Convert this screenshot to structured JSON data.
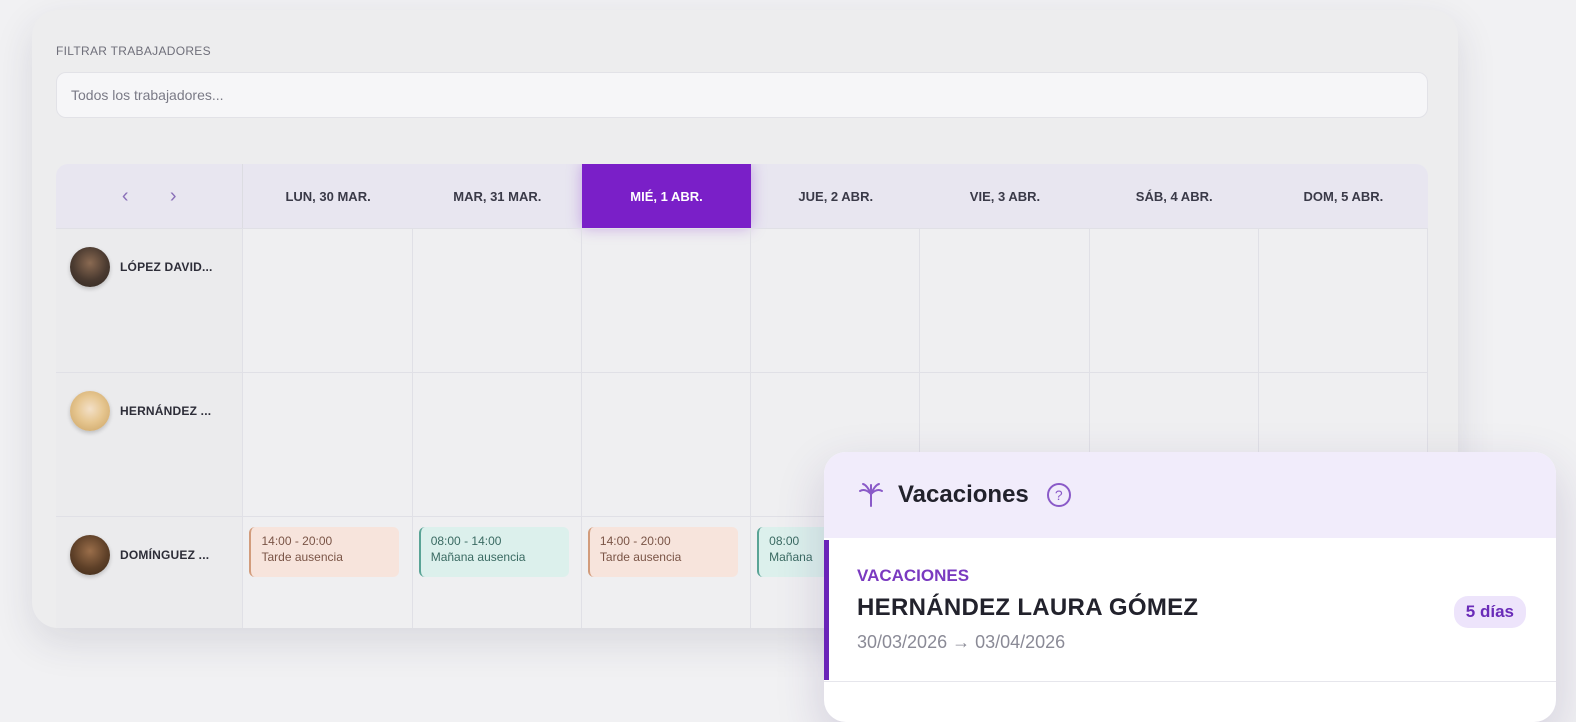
{
  "filter": {
    "label": "FILTRAR TRABAJADORES",
    "placeholder": "Todos los trabajadores..."
  },
  "calendar": {
    "nav": {
      "prev_icon": "chevron-left-icon",
      "next_icon": "chevron-right-icon"
    },
    "days": [
      {
        "label": "LUN, 30 MAR.",
        "today": false
      },
      {
        "label": "MAR, 31 MAR.",
        "today": false
      },
      {
        "label": "MIÉ, 1 ABR.",
        "today": true
      },
      {
        "label": "JUE, 2 ABR.",
        "today": false
      },
      {
        "label": "VIE, 3 ABR.",
        "today": false
      },
      {
        "label": "SÁB, 4 ABR.",
        "today": false
      },
      {
        "label": "DOM, 5 ABR.",
        "today": false
      }
    ],
    "employees": [
      {
        "name": "LÓPEZ DAVID..."
      },
      {
        "name": "HERNÁNDEZ ..."
      },
      {
        "name": "DOMÍNGUEZ ..."
      }
    ],
    "shifts": [
      {
        "time": "14:00 - 20:00",
        "label": "Tarde ausencia",
        "kind": "tarde"
      },
      {
        "time": "08:00 - 14:00",
        "label": "Mañana ausencia",
        "kind": "manana"
      },
      {
        "time": "14:00 - 20:00",
        "label": "Tarde ausencia",
        "kind": "tarde"
      },
      {
        "time": "08:00",
        "label": "Mañana",
        "kind": "manana"
      }
    ]
  },
  "popover": {
    "icon": "palm-tree-icon",
    "title": "Vacaciones",
    "help_icon": "question-circle-icon",
    "item": {
      "type": "VACACIONES",
      "name": "HERNÁNDEZ LAURA GÓMEZ",
      "dates": "30/03/2026 → 03/04/2026",
      "badge": "5 días"
    }
  },
  "colors": {
    "accent": "#7a1fc8",
    "tarde_bg": "#f7e4dc",
    "manana_bg": "#dcf0ec"
  }
}
